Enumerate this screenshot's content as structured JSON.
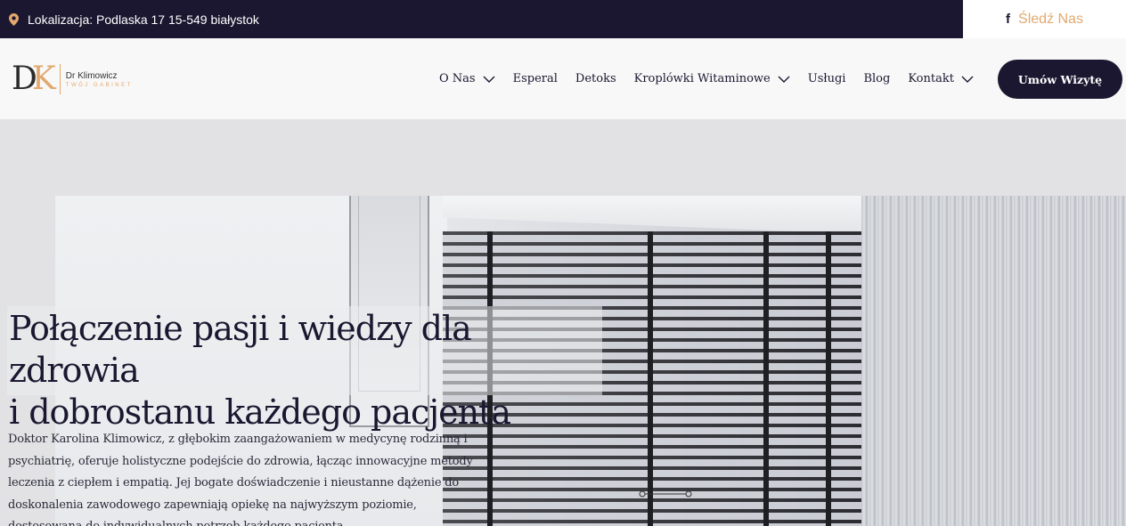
{
  "topbar": {
    "location": "Lokalizacja: Podlaska 17 15-549 białystok",
    "location_icon": "map-pin-icon",
    "follow_label": "Śledź Nas",
    "follow_icon": "facebook-icon",
    "follow_icon_glyph": "f",
    "bg_color": "#1b1730",
    "accent_color": "#e2a86d"
  },
  "logo": {
    "mark_d": "D",
    "mark_k": "K",
    "name": "Dr Klimowicz",
    "tagline": "TWÓJ GABINET"
  },
  "nav": {
    "items": [
      {
        "label": "O Nas",
        "has_dropdown": true
      },
      {
        "label": "Esperal",
        "has_dropdown": false
      },
      {
        "label": "Detoks",
        "has_dropdown": false
      },
      {
        "label": "Kroplówki Witaminowe",
        "has_dropdown": true
      },
      {
        "label": "Usługi",
        "has_dropdown": false
      },
      {
        "label": "Blog",
        "has_dropdown": false
      },
      {
        "label": "Kontakt",
        "has_dropdown": true
      }
    ],
    "cta_label": "Umów Wizytę"
  },
  "hero": {
    "title_line1": "Połączenie pasji i wiedzy dla zdrowia",
    "title_line2": "i dobrostanu każdego pacjenta",
    "description": "Doktor Karolina Klimowicz, z głębokim zaangażowaniem w medycynę rodzinną i psychiatrię, oferuje holistyczne podejście do zdrowia, łącząc innowacyjne metody leczenia z ciepłem i empatią. Jej bogate doświadczenie i nieustanne dążenie do doskonalenia zawodowego zapewniają opiekę na najwyższym poziomie, dostosowaną do indywidualnych potrzeb każdego pacjenta."
  }
}
